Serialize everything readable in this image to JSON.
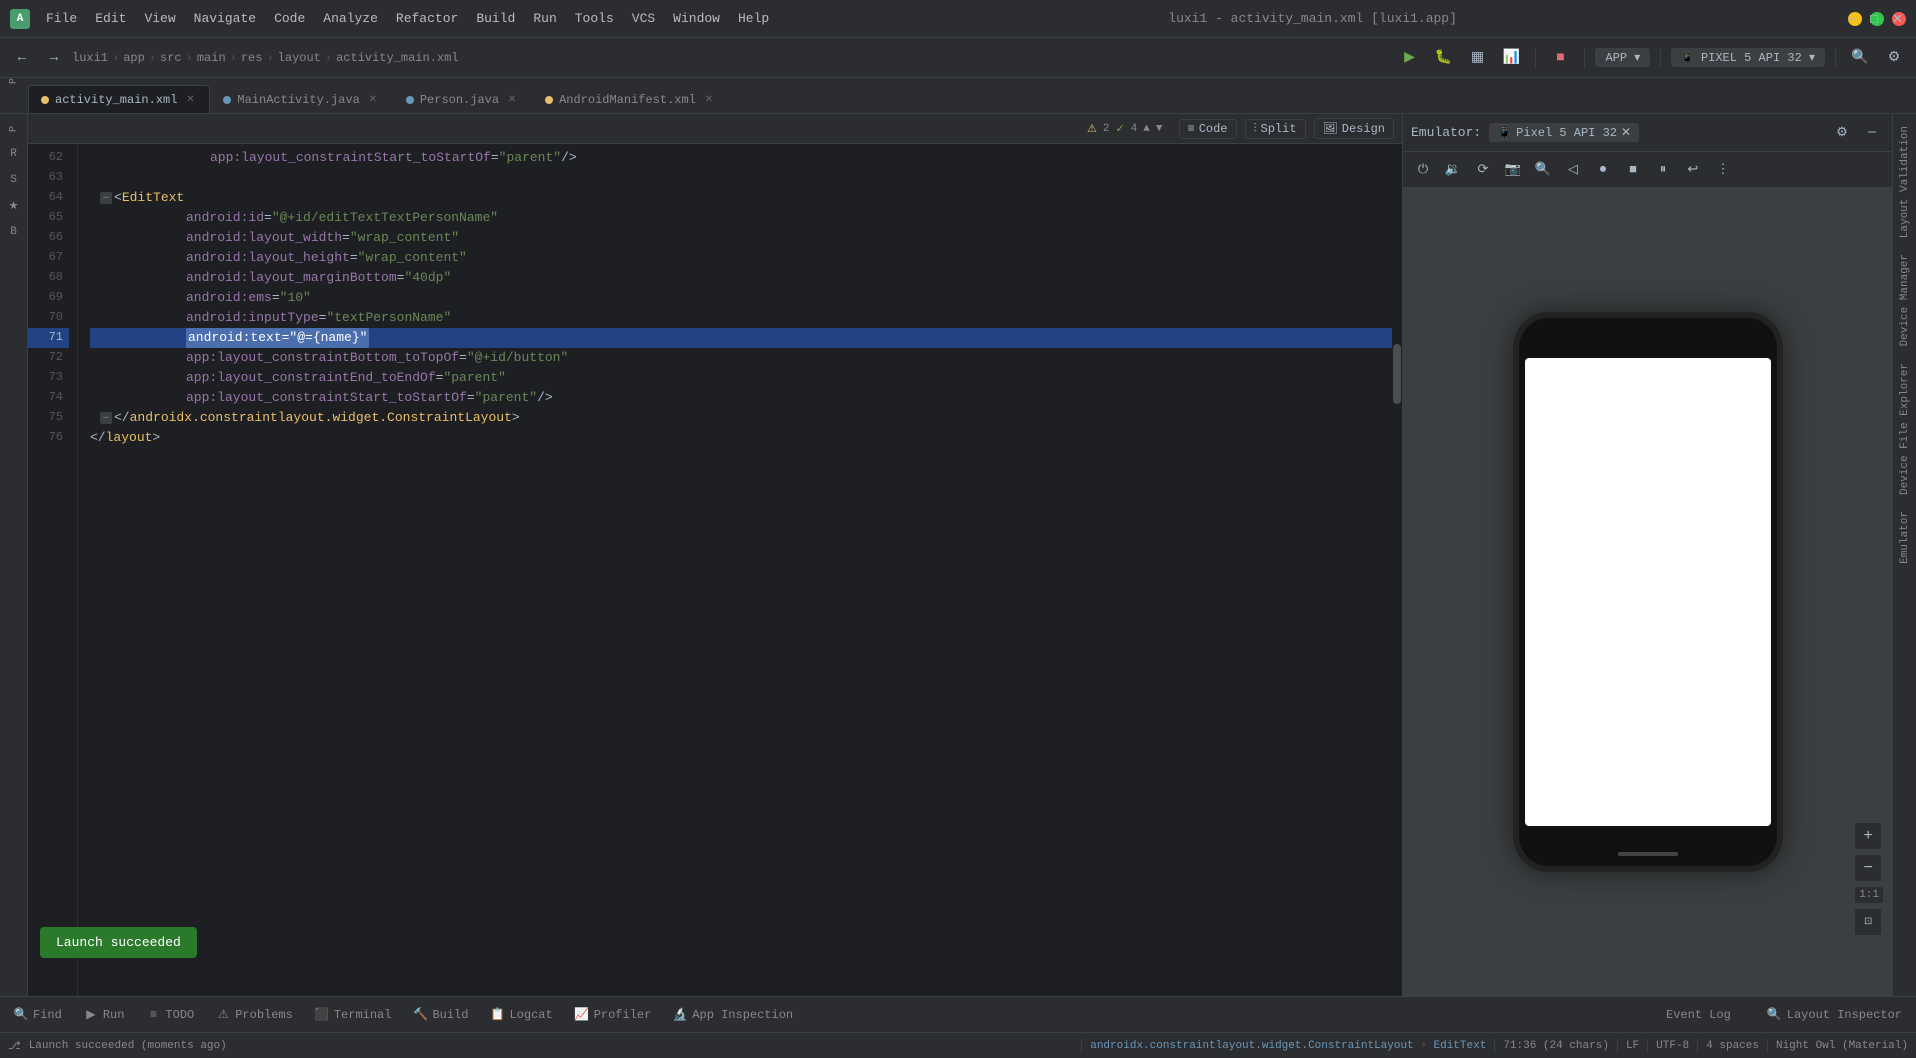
{
  "app": {
    "title": "luxi1 - activity_main.xml [luxi1.app]",
    "icon_letter": "A"
  },
  "menu": {
    "items": [
      "File",
      "Edit",
      "View",
      "Navigate",
      "Code",
      "Analyze",
      "Refactor",
      "Build",
      "Run",
      "Tools",
      "VCS",
      "Window",
      "Help"
    ]
  },
  "breadcrumb": {
    "items": [
      "luxi1",
      "app",
      "src",
      "main",
      "res",
      "layout",
      "activity_main.xml"
    ]
  },
  "tabs": [
    {
      "label": "activity_main.xml",
      "color": "#e8bf6a",
      "active": true
    },
    {
      "label": "MainActivity.java",
      "color": "#6897bb",
      "active": false
    },
    {
      "label": "Person.java",
      "color": "#6897bb",
      "active": false
    },
    {
      "label": "AndroidManifest.xml",
      "color": "#e8bf6a",
      "active": false
    }
  ],
  "editor_toolbar": {
    "code_label": "Code",
    "split_label": "Split",
    "design_label": "Design",
    "warnings": "2",
    "checks": "4"
  },
  "code_lines": [
    {
      "num": 62,
      "content": "app_start",
      "type": "xml",
      "indent": 8
    },
    {
      "num": 63,
      "content": "",
      "type": "empty"
    },
    {
      "num": 64,
      "content": "edittext_open",
      "type": "xml"
    },
    {
      "num": 65,
      "content": "android_id",
      "type": "xml",
      "indent": 12
    },
    {
      "num": 66,
      "content": "android_width",
      "type": "xml",
      "indent": 12
    },
    {
      "num": 67,
      "content": "android_height",
      "type": "xml",
      "indent": 12
    },
    {
      "num": 68,
      "content": "android_margin",
      "type": "xml",
      "indent": 12
    },
    {
      "num": 69,
      "content": "android_ems",
      "type": "xml",
      "indent": 12
    },
    {
      "num": 70,
      "content": "android_input",
      "type": "xml",
      "indent": 12
    },
    {
      "num": 71,
      "content": "android_text",
      "type": "xml",
      "indent": 12,
      "selected": true
    },
    {
      "num": 72,
      "content": "app_constraint_bottom",
      "type": "xml",
      "indent": 12
    },
    {
      "num": 73,
      "content": "app_constraint_end",
      "type": "xml",
      "indent": 12
    },
    {
      "num": 74,
      "content": "app_constraint_start",
      "type": "xml",
      "indent": 12
    },
    {
      "num": 75,
      "content": "close_constraint",
      "type": "xml",
      "indent": 4
    },
    {
      "num": 76,
      "content": "close_layout",
      "type": "xml"
    }
  ],
  "emulator": {
    "label": "Emulator:",
    "device": "Pixel 5 API 32",
    "zoom_plus": "+",
    "zoom_minus": "−",
    "zoom_label": "1:1"
  },
  "bottom_tabs": [
    {
      "icon": "🔍",
      "label": "Find"
    },
    {
      "icon": "▶",
      "label": "Run"
    },
    {
      "icon": "≡",
      "label": "TODO"
    },
    {
      "icon": "⚠",
      "label": "Problems"
    },
    {
      "icon": "⬛",
      "label": "Terminal"
    },
    {
      "icon": "🔨",
      "label": "Build"
    },
    {
      "icon": "📊",
      "label": "Logcat"
    },
    {
      "icon": "📈",
      "label": "Profiler"
    },
    {
      "icon": "🔬",
      "label": "App Inspection"
    }
  ],
  "toast": {
    "message": "Launch succeeded"
  },
  "status_bar": {
    "launch_message": "Launch succeeded (moments ago)",
    "position": "71:36 (24 chars)",
    "encoding": "LF",
    "charset": "UTF-8",
    "indent": "4 spaces",
    "theme": "Night Owl (Material)"
  },
  "right_vtabs": [
    "Layout Validation",
    "Device Manager",
    "Device File Explorer",
    "Emulator"
  ],
  "layout_inspector_label": "Layout Inspector",
  "event_log_label": "Event Log"
}
